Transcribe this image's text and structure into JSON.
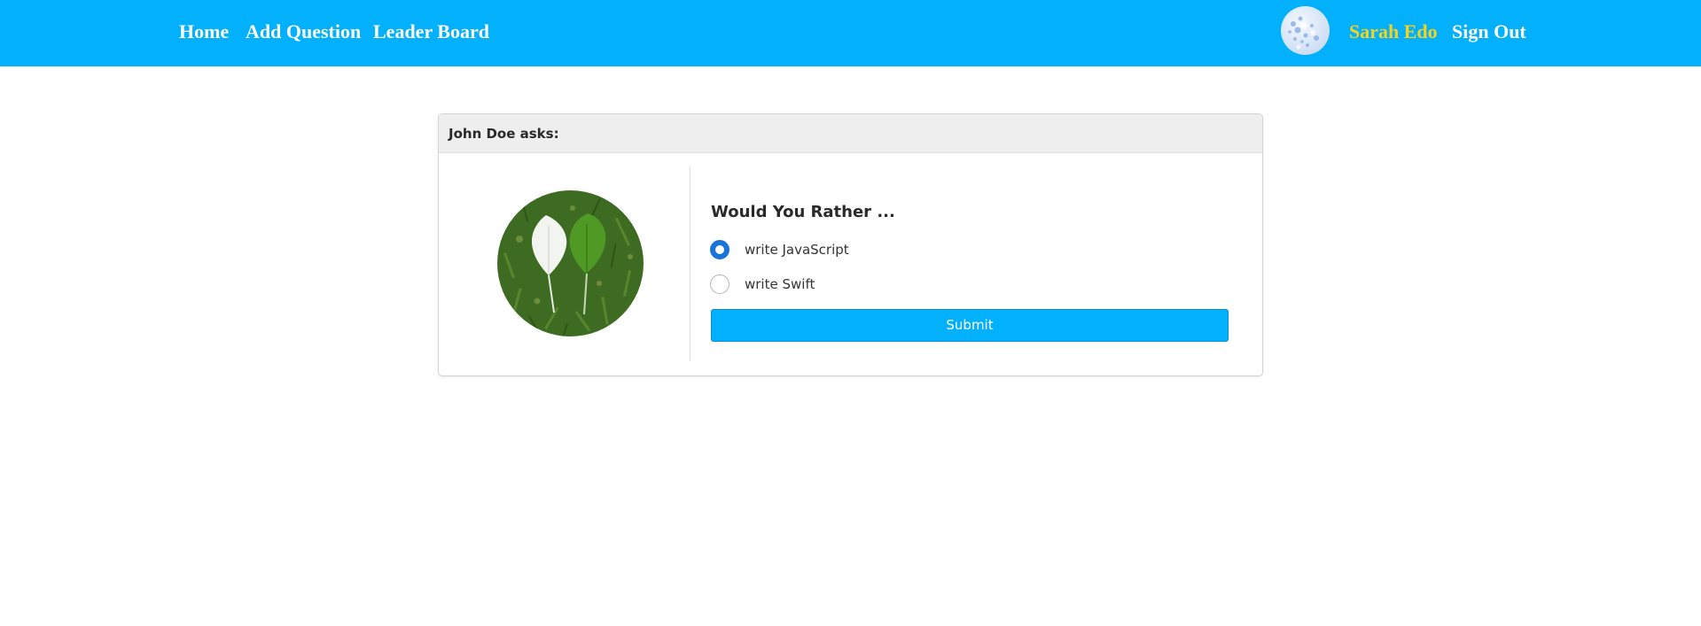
{
  "nav": {
    "home_label": "Home",
    "add_question_label": "Add Question",
    "leader_board_label": "Leader Board",
    "user_name": "Sarah Edo",
    "sign_out_label": "Sign Out",
    "bar_color": "#03b0fc",
    "user_name_color": "#f5d21b"
  },
  "question_card": {
    "header": "John Doe asks:",
    "title": "Would You Rather ...",
    "options": [
      {
        "label": "write JavaScript",
        "selected": true
      },
      {
        "label": "write Swift",
        "selected": false
      }
    ],
    "submit_label": "Submit"
  }
}
